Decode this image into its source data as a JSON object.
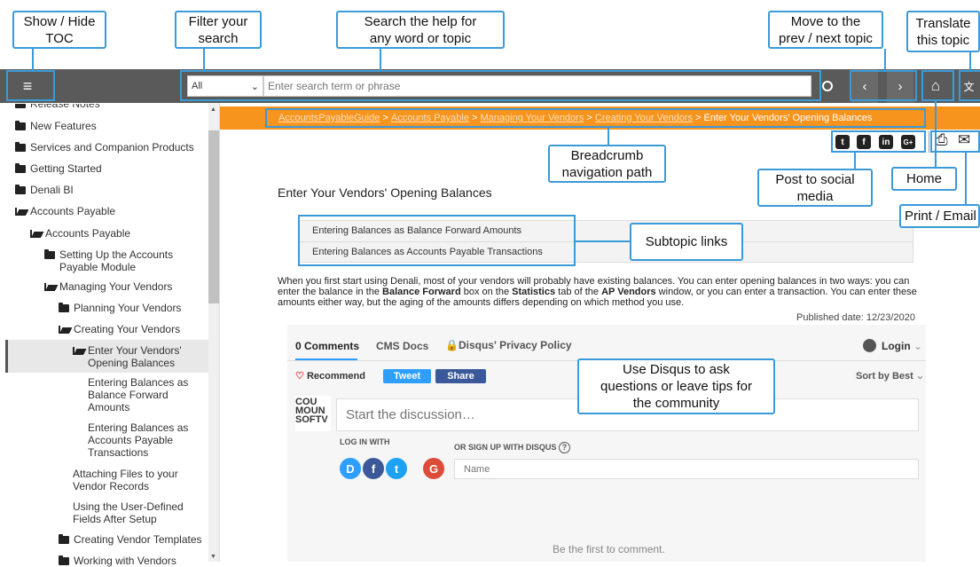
{
  "callouts": {
    "toc": "Show / Hide\nTOC",
    "filter": "Filter your\nsearch",
    "search": "Search the help for\nany word or topic",
    "prevnext": "Move to the\nprev / next topic",
    "translate": "Translate\nthis topic",
    "breadcrumb": "Breadcrumb\nnavigation path",
    "social": "Post to social\nmedia",
    "home": "Home",
    "print": "Print / Email",
    "subtopic": "Subtopic links",
    "disqus": "Use Disqus to ask\nquestions or leave tips for\nthe community"
  },
  "toolbar": {
    "menu_icon": "≡",
    "filter_value": "All",
    "filter_caret": "⌄",
    "search_placeholder": "Enter search term or phrase",
    "search_icon": "🔍",
    "prev_icon": "‹",
    "next_icon": "›",
    "home_icon": "⌂",
    "translate_icon": "文"
  },
  "sidebar": {
    "items": [
      {
        "label": "Release Notes"
      },
      {
        "label": "New Features"
      },
      {
        "label": "Services and Companion Products"
      },
      {
        "label": "Getting Started"
      },
      {
        "label": "Denali BI"
      },
      {
        "label": "Accounts Payable"
      },
      {
        "label": "Accounts Payable"
      },
      {
        "label": "Setting Up the Accounts\nPayable Module"
      },
      {
        "label": "Managing Your Vendors"
      },
      {
        "label": "Planning Your Vendors"
      },
      {
        "label": "Creating Your Vendors"
      },
      {
        "label": "Enter Your Vendors'\nOpening Balances"
      },
      {
        "label": "Entering Balances as\nBalance Forward\nAmounts"
      },
      {
        "label": "Entering Balances as\nAccounts Payable\nTransactions"
      },
      {
        "label": "Attaching Files to your\nVendor Records"
      },
      {
        "label": "Using the User-Defined\nFields After Setup"
      },
      {
        "label": "Creating Vendor Templates"
      },
      {
        "label": "Working with Vendors"
      }
    ]
  },
  "breadcrumb": {
    "c1": "AccountsPayableGuide",
    "sep": " > ",
    "c2": "Accounts Payable",
    "c3": "Managing Your Vendors",
    "c4": "Creating Your Vendors",
    "current": "Enter Your Vendors' Opening Balances"
  },
  "social": {
    "twitter": "t",
    "facebook": "f",
    "linkedin": "in",
    "google": "G+",
    "print": "⎙",
    "email": "✉"
  },
  "page": {
    "title": "Enter Your Vendors' Opening Balances",
    "sub1": "Entering Balances as Balance Forward Amounts",
    "sub2": "Entering Balances as Accounts Payable Transactions",
    "body_a": "When you first start using Denali, most of your vendors will probably have existing balances. You can enter opening balances in two ways: you can enter the balance in the ",
    "body_b": "Balance Forward",
    "body_c": " box on the ",
    "body_d": "Statistics",
    "body_e": " tab of the ",
    "body_f": "AP Vendors",
    "body_g": " window, or you can enter a transaction. You can enter these amounts either way, but the aging of the amounts differs depending on which method you use.",
    "published": "Published date: 12/23/2020"
  },
  "disqus": {
    "comments": "0 Comments",
    "cms": "CMS Docs",
    "privacy": "Disqus' Privacy Policy",
    "login": "Login",
    "recommend": "Recommend",
    "tweet": "Tweet",
    "share": "Share",
    "sort": "Sort by Best",
    "avatar_text": "COU\nMOUN\nSOFTV",
    "start": "Start the discussion…",
    "log_in_with": "LOG IN WITH",
    "sign_up": "OR SIGN UP WITH DISQUS",
    "name_placeholder": "Name",
    "first": "Be the first to comment.",
    "b_disqus": "D",
    "b_facebook": "f",
    "b_twitter": "t",
    "b_google": "G"
  },
  "colors": {
    "toolbar": "#5a5a5a",
    "breadcrumb": "#f7941d",
    "callout_border": "#3b9ad9",
    "disqus_blue": "#2e9fff"
  }
}
